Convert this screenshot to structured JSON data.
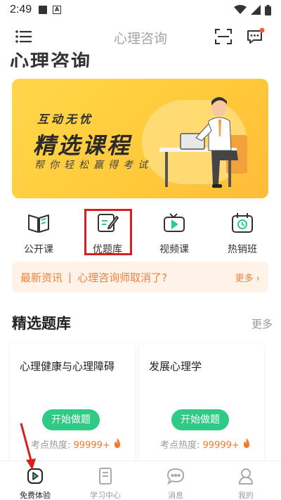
{
  "status_bar": {
    "time": "2:49",
    "a_icon_text": "A"
  },
  "header": {
    "title": "心理咨询"
  },
  "page_title": "心理咨询",
  "banner": {
    "line1": "互动无忧",
    "line2": "精选课程",
    "line3": "帮你轻松赢得考试"
  },
  "categories": [
    {
      "label": "公开课",
      "icon": "open-book-icon"
    },
    {
      "label": "优题库",
      "icon": "edit-note-icon"
    },
    {
      "label": "视频课",
      "icon": "tv-play-icon"
    },
    {
      "label": "热销班",
      "icon": "calendar-clock-icon"
    }
  ],
  "news": {
    "tag": "最新资讯",
    "separator": "|",
    "text": "心理咨询师取消了?",
    "more": "更多 ›"
  },
  "question_bank": {
    "title": "精选题库",
    "more": "更多",
    "cards": [
      {
        "title": "心理健康与心理障碍",
        "button": "开始做题",
        "heat_label": "考点热度:",
        "heat_value": "99999+"
      },
      {
        "title": "发展心理学",
        "button": "开始做题",
        "heat_label": "考点热度:",
        "heat_value": "99999+"
      }
    ]
  },
  "tabbar": [
    {
      "label": "免费体验",
      "icon": "play-square-icon",
      "active": true
    },
    {
      "label": "学习中心",
      "icon": "document-icon",
      "active": false
    },
    {
      "label": "消息",
      "icon": "chat-bubble-icon",
      "active": false
    },
    {
      "label": "我的",
      "icon": "user-icon",
      "active": false
    }
  ],
  "colors": {
    "accent_green": "#2fcb86",
    "accent_orange": "#f0813a",
    "banner_yellow": "#ffc93a",
    "highlight_red": "#d81e1e"
  }
}
